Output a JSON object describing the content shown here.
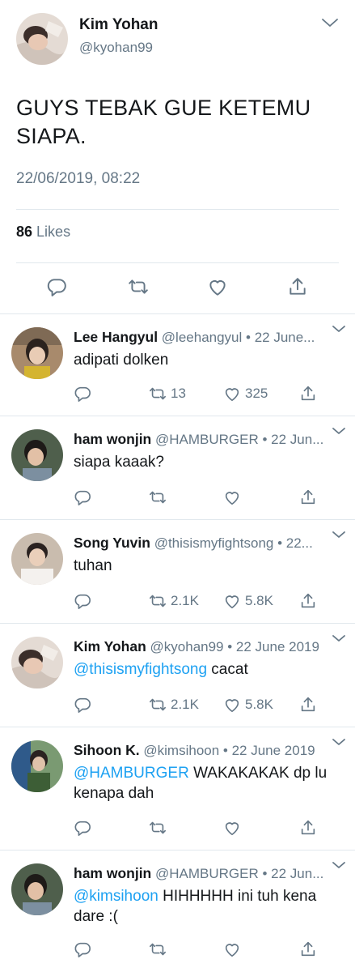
{
  "main_tweet": {
    "name": "Kim Yohan",
    "handle": "@kyohan99",
    "text": "GUYS TEBAK GUE KETEMU SIAPA.",
    "timestamp": "22/06/2019, 08:22",
    "likes_count": "86",
    "likes_label": "Likes",
    "avatar_color": "#d9cfc8"
  },
  "replies": [
    {
      "name": "Lee Hangyul",
      "meta": "@leehangyul • 22 June...",
      "mention": "",
      "text": "adipati dolken",
      "retweets": "13",
      "likes": "325",
      "avatar_color": "#b89a7c"
    },
    {
      "name": "ham wonjin",
      "meta": "@HAMBURGER • 22 Jun...",
      "mention": "",
      "text": "siapa kaaak?",
      "retweets": "",
      "likes": "",
      "avatar_color": "#5a6a55"
    },
    {
      "name": "Song Yuvin",
      "meta": "@thisismyfightsong • 22...",
      "mention": "",
      "text": "tuhan",
      "retweets": "2.1K",
      "likes": "5.8K",
      "avatar_color": "#cdbfb3"
    },
    {
      "name": "Kim Yohan",
      "meta": "@kyohan99 • 22 June 2019",
      "mention": "@thisismyfightsong",
      "text": " cacat",
      "retweets": "2.1K",
      "likes": "5.8K",
      "avatar_color": "#d9cfc8"
    },
    {
      "name": "Sihoon K.",
      "meta": "@kimsihoon • 22 June 2019",
      "mention": "@HAMBURGER",
      "text": " WAKAKAKAK dp lu kenapa dah",
      "retweets": "",
      "likes": "",
      "avatar_color": "#6f8a67"
    },
    {
      "name": "ham wonjin",
      "meta": "@HAMBURGER • 22 Jun...",
      "mention": "@kimsihoon",
      "text": " HIHHHHH ini tuh kena dare :(",
      "retweets": "",
      "likes": "",
      "avatar_color": "#5a6a55"
    }
  ],
  "icons": {
    "reply": "reply-icon",
    "retweet": "retweet-icon",
    "like": "heart-icon",
    "share": "share-icon",
    "more": "chevron-down-icon"
  },
  "colors": {
    "link": "#1da1f2",
    "secondary_text": "#657786",
    "primary_text": "#14171a",
    "divider": "#e1e8ed"
  }
}
